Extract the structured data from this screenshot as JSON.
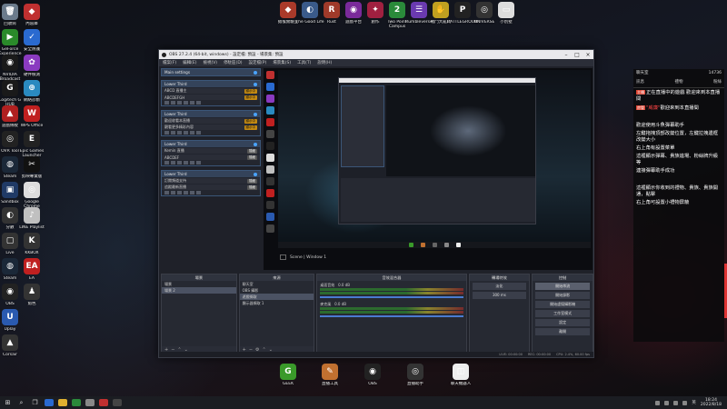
{
  "desktop": {
    "left_icons": [
      {
        "label": "回收筒",
        "color": "#6b7b8c",
        "glyph": "🗑"
      },
      {
        "label": "GeForce Experience",
        "color": "#2a8a2a",
        "glyph": "▶"
      },
      {
        "label": "NVIDIA Broadcast",
        "color": "#1a1a1a",
        "glyph": "◉"
      },
      {
        "label": "Logitech G HUB",
        "color": "#1a1a1a",
        "glyph": "G"
      },
      {
        "label": "遊戲條紋",
        "color": "#b02020",
        "glyph": "▲"
      },
      {
        "label": "OVR Tool",
        "color": "#222",
        "glyph": "◎"
      },
      {
        "label": "Steam",
        "color": "#1b2838",
        "glyph": "◍"
      },
      {
        "label": "Sandbox",
        "color": "#203a66",
        "glyph": "▣"
      },
      {
        "label": "分數",
        "color": "#333",
        "glyph": "◐"
      },
      {
        "label": "Live",
        "color": "#333",
        "glyph": "▢"
      },
      {
        "label": "Steam",
        "color": "#1b2838",
        "glyph": "◍"
      },
      {
        "label": "OBS",
        "color": "#222",
        "glyph": "◉"
      },
      {
        "label": "Uplay",
        "color": "#2a5ab0",
        "glyph": "U"
      },
      {
        "label": "Corsair",
        "color": "#333",
        "glyph": "▲"
      }
    ],
    "second_col_icons": [
      {
        "label": "內容庫",
        "color": "#c03030",
        "glyph": "◆"
      },
      {
        "label": "安全防護",
        "color": "#2a6ad0",
        "glyph": "✓"
      },
      {
        "label": "硬件檢測",
        "color": "#8a3ac0",
        "glyph": "✿"
      },
      {
        "label": "網絡診斷",
        "color": "#2a8ac0",
        "glyph": "⊕"
      },
      {
        "label": "WPS Office",
        "color": "#c02020",
        "glyph": "W"
      },
      {
        "label": "Epic Games Launcher",
        "color": "#222",
        "glyph": "E"
      },
      {
        "label": "剪映專業版",
        "color": "#111",
        "glyph": "✂"
      },
      {
        "label": "Google Chrome",
        "color": "#ddd",
        "glyph": "◎"
      },
      {
        "label": "LINE Playlist",
        "color": "#c0c0c0",
        "glyph": "♪"
      },
      {
        "label": "KKBOX",
        "color": "#333",
        "glyph": "K"
      },
      {
        "label": "EA",
        "color": "#c02020",
        "glyph": "EA"
      },
      {
        "label": "角色",
        "color": "#333",
        "glyph": "♟"
      }
    ],
    "top_icons": [
      {
        "label": "猿猴實驗室",
        "color": "#aa3a2a",
        "glyph": "◆"
      },
      {
        "label": "The Good Life",
        "color": "#3a5a8a",
        "glyph": "◐"
      },
      {
        "label": "Rust",
        "color": "#a03a2a",
        "glyph": "R"
      },
      {
        "label": "遊戲平台",
        "color": "#7a2a9a",
        "glyph": "◉"
      },
      {
        "label": "創作",
        "color": "#a02040",
        "glyph": "✦"
      },
      {
        "label": "Two Point Campus",
        "color": "#2a8a3a",
        "glyph": "2"
      },
      {
        "label": "Rumbleverse",
        "color": "#6a3ab0",
        "glyph": "☰"
      },
      {
        "label": "戰鬥大亂鬥",
        "color": "#c0a020",
        "glyph": "✋"
      },
      {
        "label": "BATTLEGROUNDS",
        "color": "#222",
        "glyph": "P"
      },
      {
        "label": "UNIVERSE",
        "color": "#333",
        "glyph": "◎"
      },
      {
        "label": "小別墅",
        "color": "#ddd",
        "glyph": "▭"
      }
    ],
    "bottom_icons": [
      {
        "label": "GEEK",
        "color": "#3a9a2a",
        "glyph": "G"
      },
      {
        "label": "直播工具",
        "color": "#c07030",
        "glyph": "✎"
      },
      {
        "label": "OBS",
        "color": "#222",
        "glyph": "◉"
      },
      {
        "label": "直播助手",
        "color": "#333",
        "glyph": "◎"
      },
      {
        "label": "聊天機器人",
        "color": "#eee",
        "glyph": "◫"
      }
    ]
  },
  "obs": {
    "title": "OBS 27.2.4 (64-bit, windows) - 設定檔: 預設 - 場景集: 預設",
    "menu": [
      "檔案(F)",
      "編輯(E)",
      "檢視(V)",
      "停駐區(D)",
      "設定檔(P)",
      "場景集(S)",
      "工具(T)",
      "說明(H)"
    ],
    "panels": [
      {
        "title": "Main settings",
        "rows": []
      },
      {
        "title": "Lower Third",
        "rows": [
          {
            "text": "ABCD 直播主",
            "badge": "顯示中"
          },
          {
            "text": "ABCDEFGH",
            "badge": "顯示中"
          }
        ]
      },
      {
        "title": "Lower Third",
        "rows": [
          {
            "text": "歡迎收看本直播",
            "badge": "顯示中"
          },
          {
            "text": "觀看更多精彩內容",
            "badge": "顯示中"
          }
        ]
      },
      {
        "title": "Lower Third",
        "rows": [
          {
            "text": "Kemin 直播",
            "badge": "隱藏"
          },
          {
            "text": "ABCDEF",
            "badge": "隱藏"
          }
        ]
      },
      {
        "title": "Lower Third",
        "rows": [
          {
            "text": "訂閱頻道支持",
            "badge": "隱藏"
          },
          {
            "text": "追蹤最新直播",
            "badge": "隱藏"
          }
        ]
      }
    ],
    "preview_toolbar": "Scene | Window 1",
    "docks": {
      "scenes": {
        "title": "場景",
        "items": [
          "場景",
          "場景 2"
        ]
      },
      "sources": {
        "title": "來源",
        "items": [
          "聊天室",
          "OBS 攝影",
          "遊戲擷取",
          "顯示器擷取 1"
        ]
      },
      "mixer": {
        "title": "音效混合器",
        "channels": [
          {
            "label": "桌面音效",
            "level": "0.0 dB"
          },
          {
            "label": "麥克風",
            "level": "0.0 dB"
          }
        ]
      },
      "transitions": {
        "title": "轉場特效",
        "type": "淡化",
        "duration": "300 ms"
      },
      "controls": {
        "title": "控制",
        "buttons": [
          "開始串流",
          "開始錄影",
          "開始虛擬攝影機",
          "工作室模式",
          "設定",
          "離開"
        ]
      }
    },
    "status": [
      "LIVE: 00:00:00",
      "REC: 00:00:00",
      "CPU: 2.4%, 60.00 fps"
    ]
  },
  "chat": {
    "header_left": "聊天室",
    "header_right": "14736",
    "tabs": [
      "訊息",
      "禮物",
      "粉絲"
    ],
    "messages": [
      {
        "tag": "主播",
        "nick": "",
        "text": "正在直播中的遊戲 歡迎來到本直播間"
      },
      {
        "tag": "房管",
        "nick": "\"威廉\"",
        "text": "歡迎來到本直播間"
      },
      {
        "tag": "",
        "nick": "",
        "text": "歡迎使用斗魚彈幕助手"
      },
      {
        "tag": "",
        "nick": "",
        "text": "左鍵拖拽頂部改變位置，左鍵拉拽邊框改變大小"
      },
      {
        "tag": "",
        "nick": "",
        "text": "右上角有設置菜單"
      },
      {
        "tag": "",
        "nick": "",
        "text": "這裡顯示彈幕、貴族進場、粉絲牌升級等"
      },
      {
        "tag": "",
        "nick": "",
        "text": "連接彈幕助手成功"
      },
      {
        "tag": "",
        "nick": "",
        "text": "這裡顯示你收到的禮物、貴族、貴族開通，點擊"
      },
      {
        "tag": "",
        "nick": "",
        "text": "右上角可設置小禮物屏蔽"
      }
    ]
  },
  "taskbar": {
    "lang": "英",
    "time": "18:24",
    "date": "2022/8/18"
  }
}
